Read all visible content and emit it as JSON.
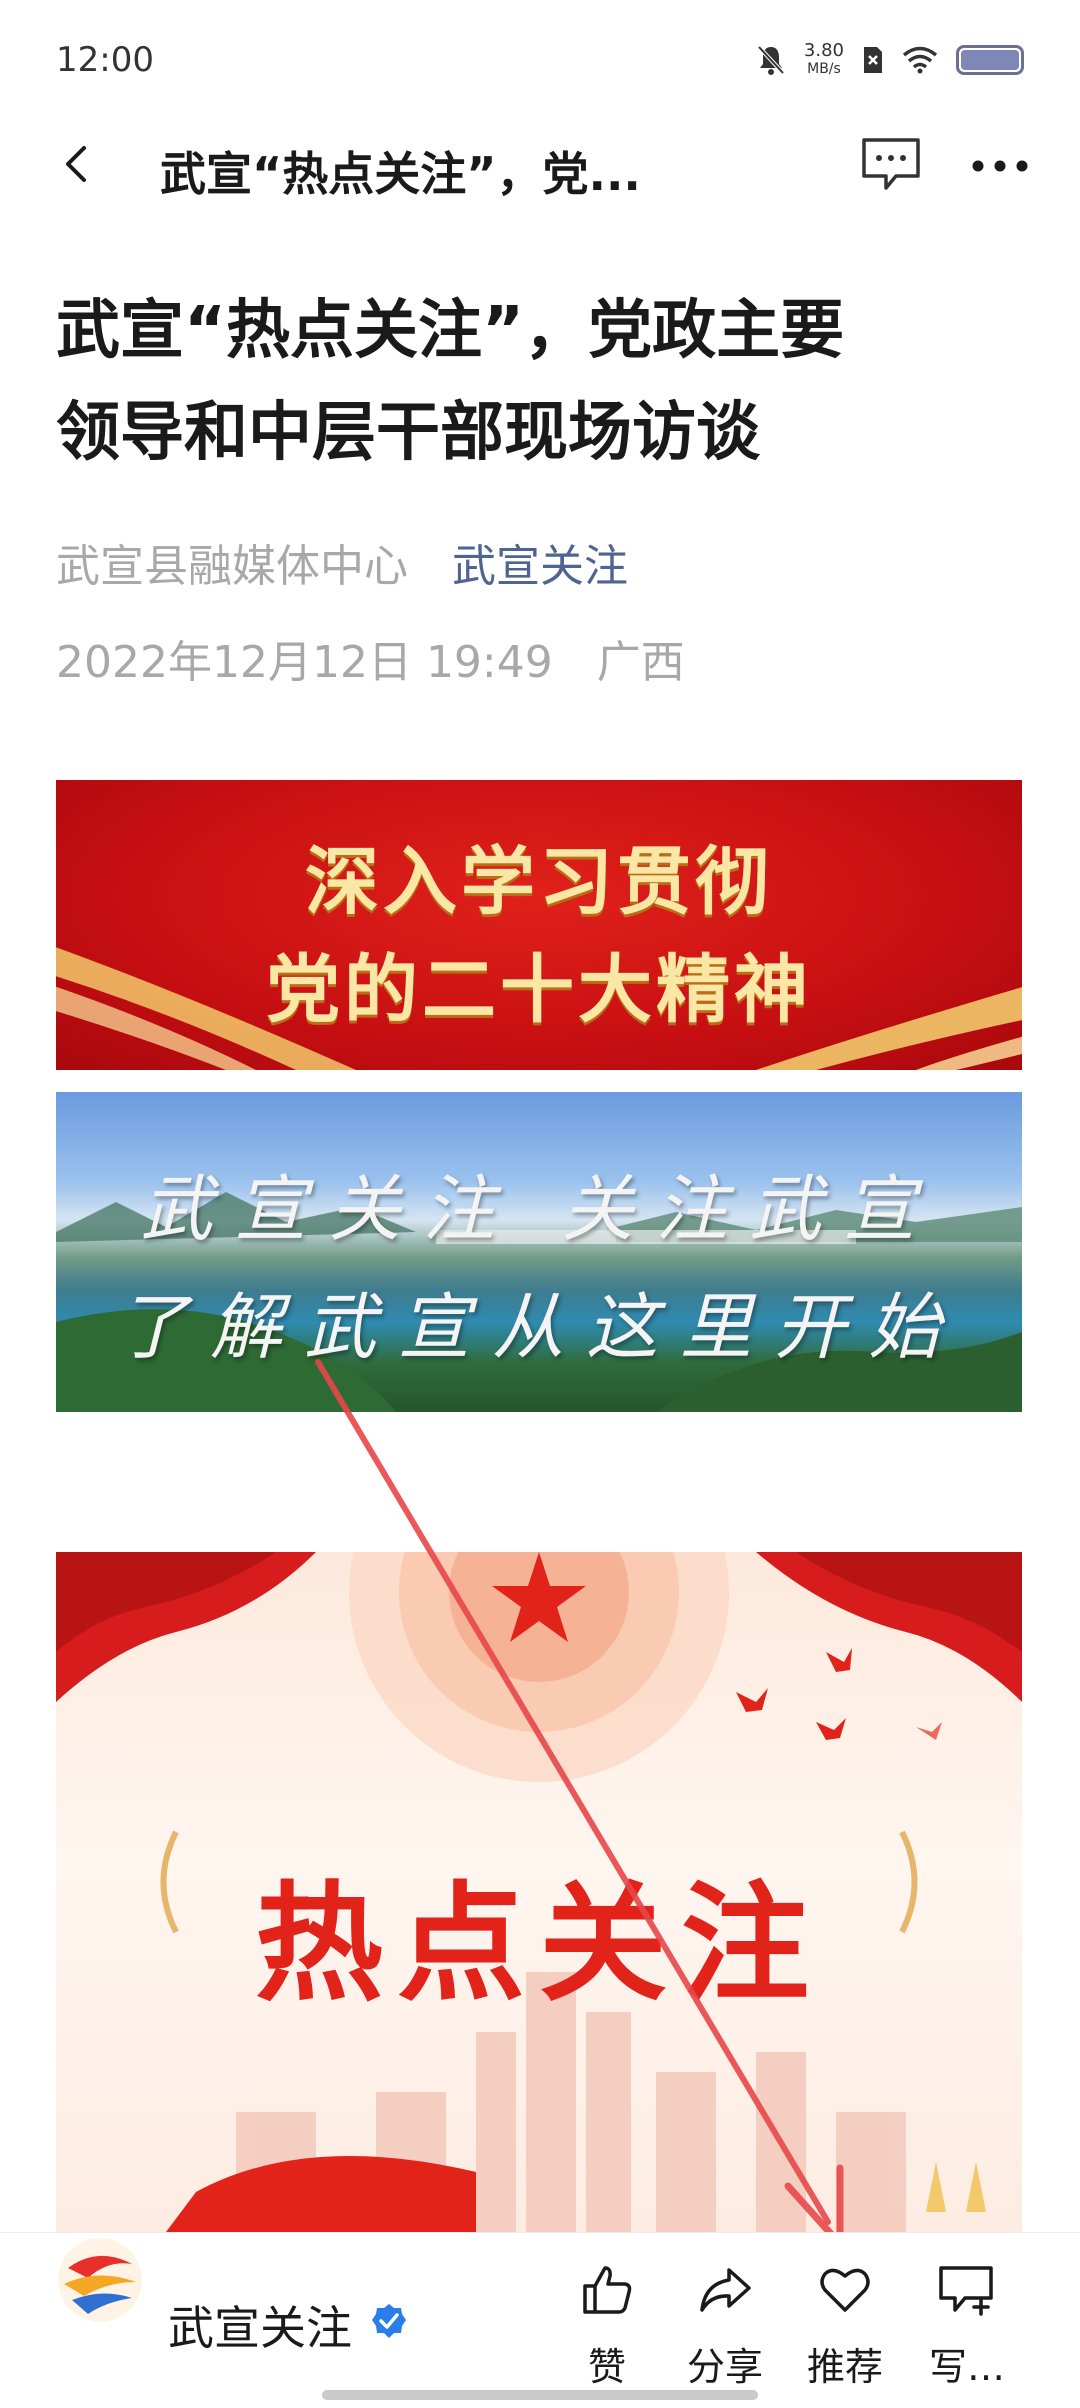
{
  "status_bar": {
    "time": "12:00",
    "net_speed_value": "3.80",
    "net_speed_unit": "MB/s",
    "icons": [
      "mute-bell-icon",
      "sim-x-icon",
      "wifi-icon",
      "battery-icon"
    ]
  },
  "nav": {
    "title": "武宣“热点关注”，党...",
    "icons": [
      "back-icon",
      "comment-icon",
      "more-icon"
    ]
  },
  "article": {
    "title_line1": "武宣“热点关注”，党政主要",
    "title_line2": "领导和中层干部现场访谈",
    "source": "武宣县融媒体中心",
    "account": "武宣关注",
    "date": "2022年12月12日 19:49",
    "region": "广西"
  },
  "banners": {
    "red_line1": "深入学习贯彻",
    "red_line2": "党的二十大精神",
    "scenic_line1": "武宣关注 关注武宣",
    "scenic_line2": "了解武宣从这里开始",
    "poster_title": "热点关注"
  },
  "bottom_bar": {
    "account_name": "武宣关注",
    "actions": [
      {
        "label": "赞",
        "icon": "thumbs-up-icon"
      },
      {
        "label": "分享",
        "icon": "share-icon"
      },
      {
        "label": "推荐",
        "icon": "heart-icon"
      },
      {
        "label": "写…",
        "icon": "write-comment-icon"
      }
    ]
  },
  "colors": {
    "account_link": "#4f6490",
    "meta_gray": "#a8a8a8",
    "banner_red": "#c70f12",
    "poster_red": "#e2231a",
    "arrow_red": "#e8474a"
  }
}
